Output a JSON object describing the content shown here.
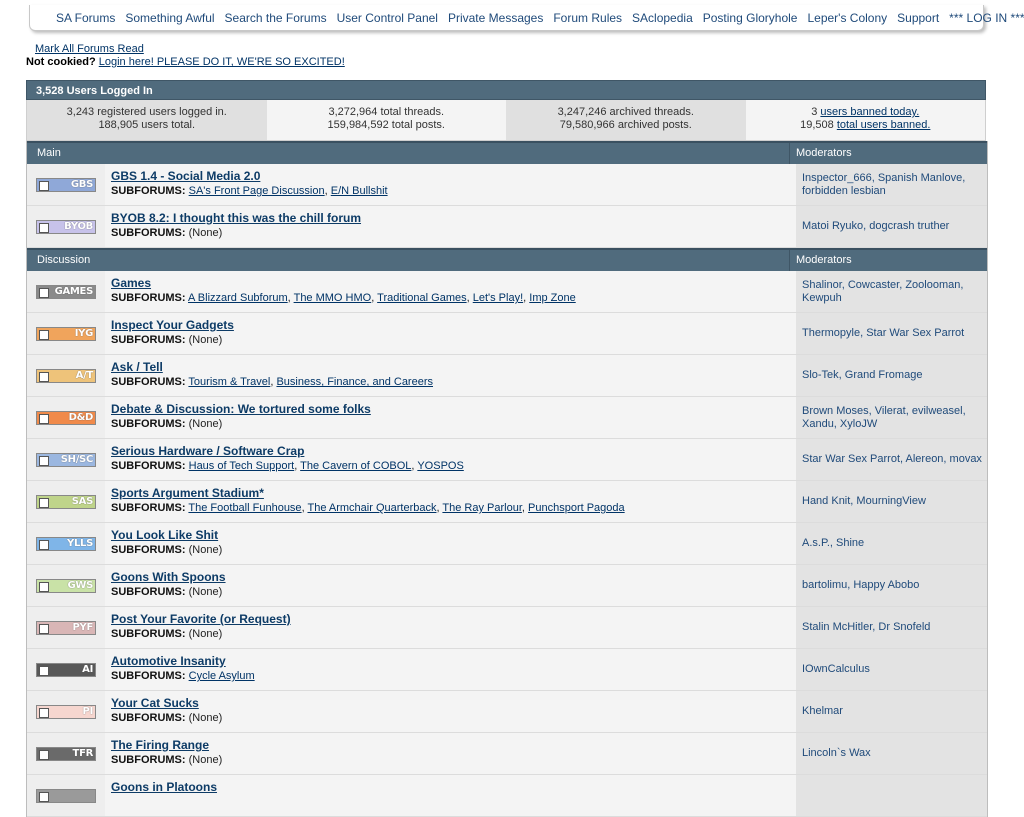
{
  "nav": {
    "links": [
      "SA Forums",
      "Something Awful",
      "Search the Forums",
      "User Control Panel",
      "Private Messages",
      "Forum Rules",
      "SAclopedia",
      "Posting Gloryhole",
      "Leper's Colony",
      "Support",
      "*** LOG IN ***"
    ]
  },
  "subnav": {
    "mark_all_read": "Mark All Forums Read",
    "not_cookied": "Not cookied?",
    "login_link": "Login here! PLEASE DO IT, WE'RE SO EXCITED!"
  },
  "stats": {
    "header": "3,528 Users Logged In",
    "registered_line1": "3,243 registered users logged in.",
    "registered_line2": "188,905 users total.",
    "threads_line1": "3,272,964 total threads.",
    "threads_line2": "159,984,592 total posts.",
    "archived_line1": "3,247,246 archived threads.",
    "archived_line2": "79,580,966 archived posts.",
    "banned_count": "3",
    "banned_today": "users banned today.",
    "total_banned_count": "19,508",
    "total_banned": "total users banned."
  },
  "sections": [
    {
      "name": "Main",
      "mods_header": "Moderators",
      "forums": [
        {
          "icon_text": "GBS",
          "icon_color": "#8fa8d8",
          "title": "GBS 1.4 - Social Media 2.0",
          "subforums": [
            "SA's Front Page Discussion",
            "E/N Bullshit"
          ],
          "mods": "Inspector_666, Spanish Manlove, forbidden lesbian"
        },
        {
          "icon_text": "BYOB",
          "icon_color": "#c7c2ea",
          "title": "BYOB 8.2: I thought this was the chill forum",
          "subforums": [],
          "mods": "Matoi Ryuko, dogcrash truther"
        }
      ]
    },
    {
      "name": "Discussion",
      "mods_header": "Moderators",
      "forums": [
        {
          "icon_text": "GAMES",
          "icon_color": "#8a8a8a",
          "title": "Games",
          "subforums": [
            "A Blizzard Subforum",
            "The MMO HMO",
            "Traditional Games",
            "Let's Play!",
            "Imp Zone"
          ],
          "mods": "Shalinor, Cowcaster, Zoolooman, Kewpuh"
        },
        {
          "icon_text": "IYG",
          "icon_color": "#f0a45c",
          "title": "Inspect Your Gadgets",
          "subforums": [],
          "mods": "Thermopyle, Star War Sex Parrot"
        },
        {
          "icon_text": "A/T",
          "icon_color": "#eec37a",
          "title": "Ask / Tell",
          "subforums": [
            "Tourism & Travel",
            "Business, Finance, and Careers"
          ],
          "mods": "Slo-Tek, Grand Fromage"
        },
        {
          "icon_text": "D&D",
          "icon_color": "#f08a4a",
          "title": "Debate & Discussion: We tortured some folks",
          "subforums": [],
          "mods": "Brown Moses, Vilerat, evilweasel, Xandu, XyloJW"
        },
        {
          "icon_text": "SH/SC",
          "icon_color": "#9bb7e0",
          "title": "Serious Hardware / Software Crap",
          "subforums": [
            "Haus of Tech Support",
            "The Cavern of COBOL",
            "YOSPOS"
          ],
          "mods": "Star War Sex Parrot, Alereon, movax"
        },
        {
          "icon_text": "SAS",
          "icon_color": "#bfd48a",
          "title": "Sports Argument Stadium*",
          "subforums": [
            "The Football Funhouse",
            "The Armchair Quarterback",
            "The Ray Parlour",
            "Punchsport Pagoda"
          ],
          "mods": "Hand Knit, MourningView"
        },
        {
          "icon_text": "YLLS",
          "icon_color": "#7fb5e8",
          "title": "You Look Like Shit",
          "subforums": [],
          "mods": "A.s.P., Shine"
        },
        {
          "icon_text": "GWS",
          "icon_color": "#c9e2a7",
          "title": "Goons With Spoons",
          "subforums": [],
          "mods": "bartolimu, Happy Abobo"
        },
        {
          "icon_text": "PYF",
          "icon_color": "#d9b6b6",
          "title": "Post Your Favorite (or Request)",
          "subforums": [],
          "mods": "Stalin McHitler, Dr Snofeld"
        },
        {
          "icon_text": "AI",
          "icon_color": "#585858",
          "title": "Automotive Insanity",
          "subforums": [
            "Cycle Asylum"
          ],
          "mods": "IOwnCalculus"
        },
        {
          "icon_text": "PI",
          "icon_color": "#f6d6cf",
          "title": "Your Cat Sucks",
          "subforums": [],
          "mods": "Khelmar"
        },
        {
          "icon_text": "TFR",
          "icon_color": "#6a6a6a",
          "title": "The Firing Range",
          "subforums": [],
          "mods": "Lincoln`s Wax"
        },
        {
          "icon_text": "",
          "icon_color": "#9a9a9a",
          "title": "Goons in Platoons",
          "subforums": [],
          "mods": ""
        }
      ]
    }
  ],
  "labels": {
    "subforums": "SUBFORUMS:",
    "none": "(None)"
  }
}
